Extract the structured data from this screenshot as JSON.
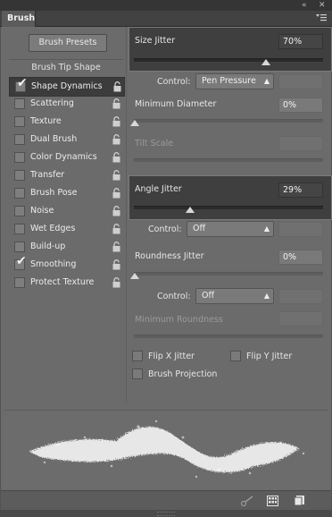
{
  "window": {
    "tab_label": "Brush",
    "collapse_icon": "double-left-arrow-icon",
    "close_icon": "close-icon",
    "menu_icon": "panel-menu-icon"
  },
  "sidebar": {
    "presets_button": "Brush Presets",
    "tip_header": "Brush Tip Shape",
    "items": [
      {
        "label": "Shape Dynamics",
        "checked": true,
        "selected": true
      },
      {
        "label": "Scattering",
        "checked": false
      },
      {
        "label": "Texture",
        "checked": false
      },
      {
        "label": "Dual Brush",
        "checked": false
      },
      {
        "label": "Color Dynamics",
        "checked": false
      },
      {
        "label": "Transfer",
        "checked": false
      },
      {
        "label": "Brush Pose",
        "checked": false
      },
      {
        "label": "Noise",
        "checked": false
      },
      {
        "label": "Wet Edges",
        "checked": false
      },
      {
        "label": "Build-up",
        "checked": false
      },
      {
        "label": "Smoothing",
        "checked": true
      },
      {
        "label": "Protect Texture",
        "checked": false
      }
    ],
    "lock_icon": "lock-icon"
  },
  "main": {
    "size_jitter": {
      "label": "Size Jitter",
      "value": "70%",
      "fraction": 0.7
    },
    "size_control": {
      "label": "Control:",
      "value": "Pen Pressure"
    },
    "min_diameter": {
      "label": "Minimum Diameter",
      "value": "0%",
      "fraction": 0
    },
    "tilt_scale": {
      "label": "Tilt Scale"
    },
    "angle_jitter": {
      "label": "Angle Jitter",
      "value": "29%",
      "fraction": 0.29
    },
    "angle_control": {
      "label": "Control:",
      "value": "Off"
    },
    "roundness_jitter": {
      "label": "Roundness Jitter",
      "value": "0%",
      "fraction": 0
    },
    "roundness_control": {
      "label": "Control:",
      "value": "Off"
    },
    "min_roundness": {
      "label": "Minimum Roundness"
    },
    "flip_x": {
      "label": "Flip X Jitter",
      "checked": false
    },
    "flip_y": {
      "label": "Flip Y Jitter",
      "checked": false
    },
    "brush_projection": {
      "label": "Brush Projection",
      "checked": false
    }
  },
  "bottom": {
    "icons": [
      "toggle-live-tip-icon",
      "grid-icon",
      "new-preset-icon"
    ]
  }
}
